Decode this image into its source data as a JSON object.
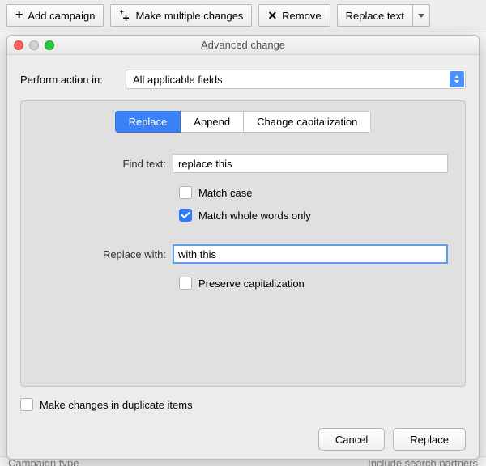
{
  "toolbar": {
    "add_campaign": "Add campaign",
    "make_multiple": "Make multiple changes",
    "remove": "Remove",
    "replace_text": "Replace text"
  },
  "dialog": {
    "title": "Advanced change",
    "perform_label": "Perform action in:",
    "perform_value": "All applicable fields",
    "tabs": {
      "replace": "Replace",
      "append": "Append",
      "change_cap": "Change capitalization"
    },
    "find_label": "Find text:",
    "find_value": "replace this",
    "match_case": "Match case",
    "match_whole": "Match whole words only",
    "replace_label": "Replace with:",
    "replace_value": "with this",
    "caret": "|",
    "preserve_cap": "Preserve capitalization",
    "duplicate_items": "Make changes in duplicate items",
    "btn_cancel": "Cancel",
    "btn_replace": "Replace"
  },
  "background": {
    "strip_left": "Campaign type",
    "strip_right": "Include search partners"
  },
  "checks": {
    "match_case": false,
    "match_whole": true,
    "preserve_cap": false,
    "duplicate": false
  }
}
